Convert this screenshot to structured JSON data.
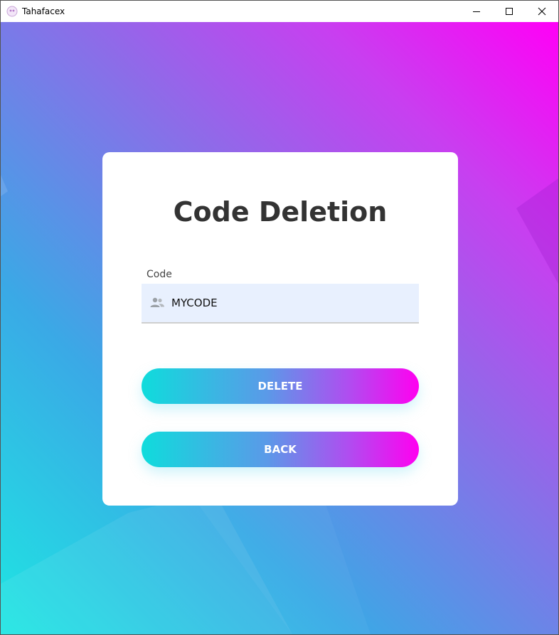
{
  "window": {
    "title": "Tahafacex",
    "controls": {
      "minimize": "minimize-icon",
      "maximize": "maximize-icon",
      "close": "close-icon"
    }
  },
  "card": {
    "title": "Code Deletion",
    "code_field": {
      "label": "Code",
      "value": "MYCODE",
      "icon": "users-icon"
    },
    "buttons": {
      "delete_label": "DELETE",
      "back_label": "BACK"
    }
  },
  "colors": {
    "background_start": "#1ee6e2",
    "background_end": "#ff00f6",
    "button_start": "#0fdcdc",
    "button_end": "#ff00f0",
    "field_bg": "#e8f0fe",
    "title_text": "#333333"
  }
}
